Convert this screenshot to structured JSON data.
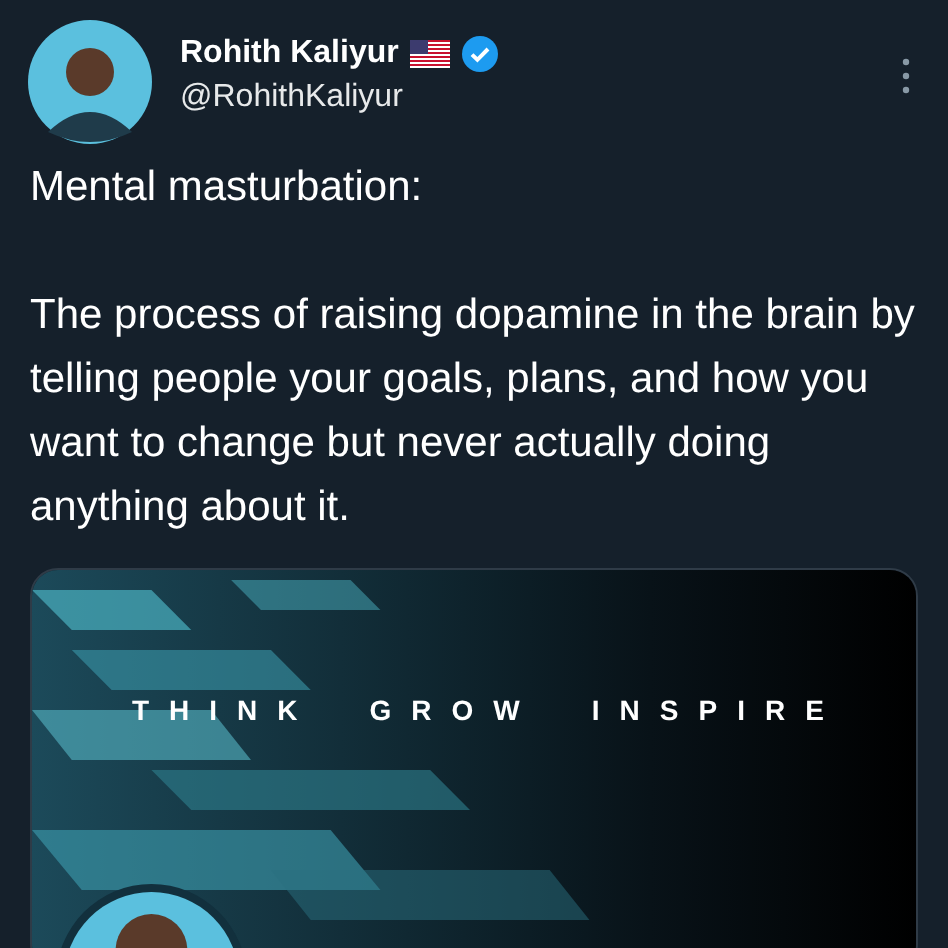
{
  "tweet": {
    "author": {
      "name": "Rohith Kaliyur",
      "handle": "@RohithKaliyur",
      "verified": true
    },
    "paragraphs": [
      "Mental masturbation:",
      "The process of raising dopamine in the brain by telling people your goals, plans, and how you want to change but never actually doing anything about it."
    ],
    "media": {
      "kind": "picture",
      "banner_words": [
        "THINK",
        "GROW",
        "INSPIRE"
      ]
    }
  }
}
